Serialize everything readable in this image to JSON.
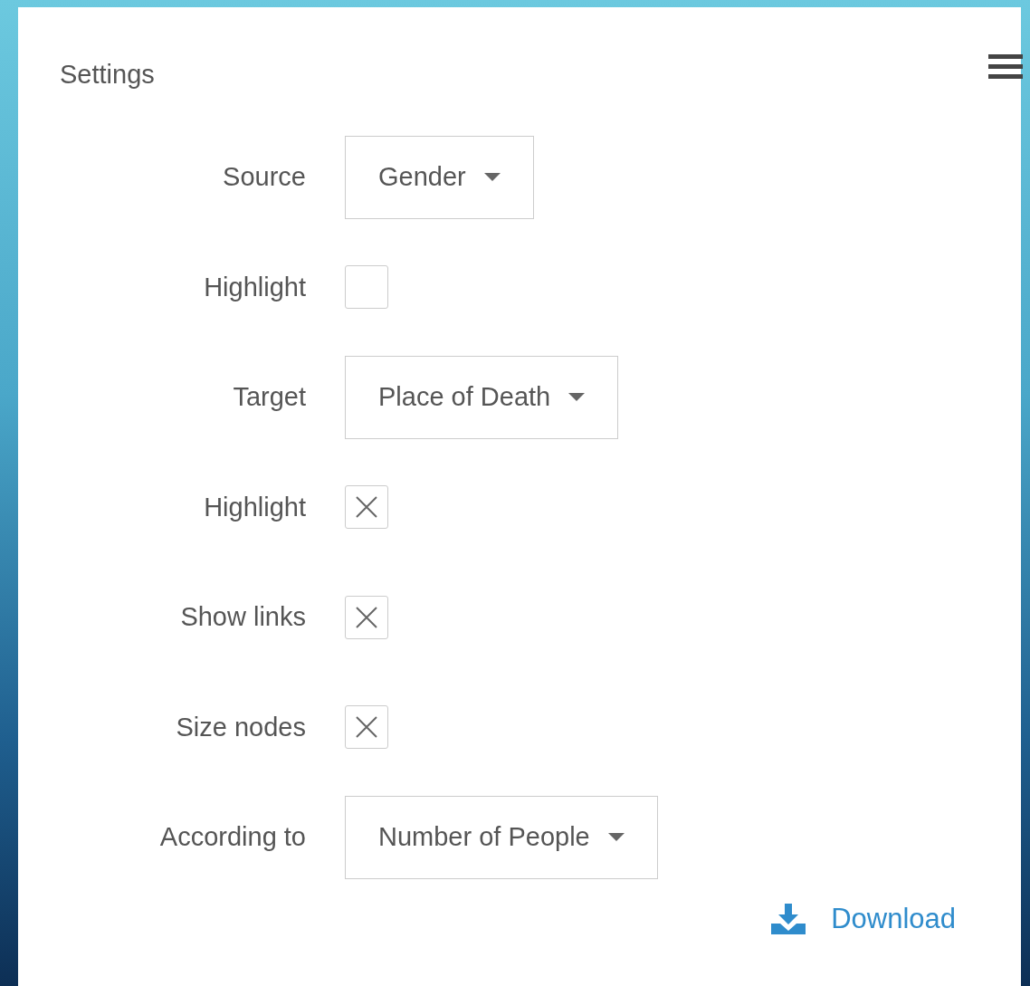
{
  "panel": {
    "title": "Settings"
  },
  "rows": [
    {
      "kind": "select",
      "label": "Source",
      "value": "Gender"
    },
    {
      "kind": "checkbox",
      "label": "Highlight",
      "checked": false
    },
    {
      "kind": "select",
      "label": "Target",
      "value": "Place of Death"
    },
    {
      "kind": "checkbox",
      "label": "Highlight",
      "checked": true
    },
    {
      "kind": "checkbox",
      "label": "Show links",
      "checked": true
    },
    {
      "kind": "checkbox",
      "label": "Size nodes",
      "checked": true
    },
    {
      "kind": "select",
      "label": "According to",
      "value": "Number of People"
    }
  ],
  "download": {
    "label": "Download"
  }
}
